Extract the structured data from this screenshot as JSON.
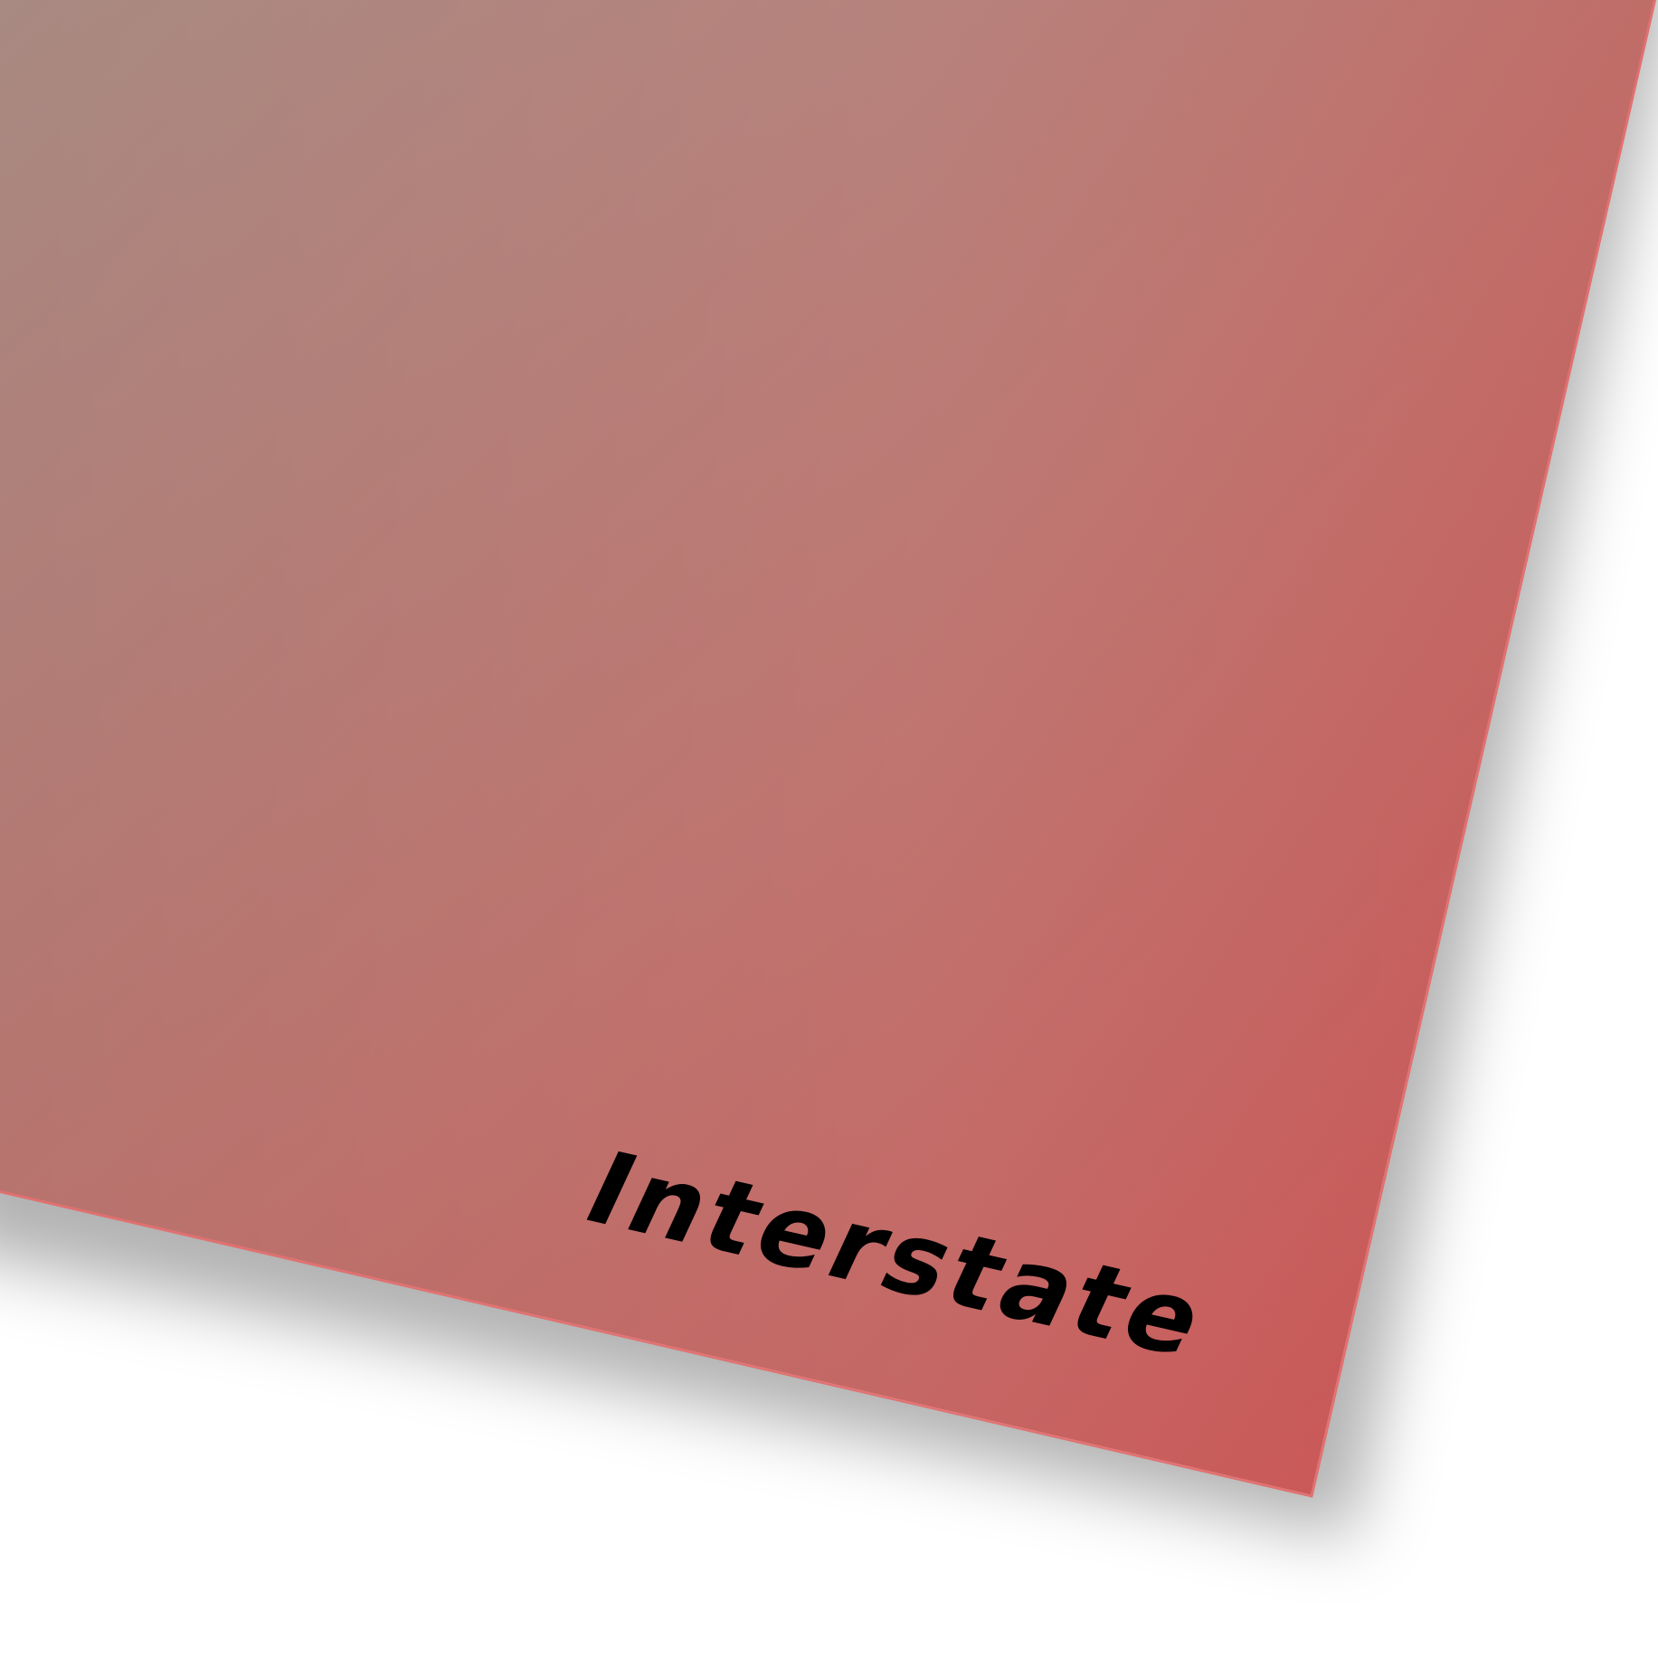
{
  "poster": {
    "caption": "Interstate",
    "colors": {
      "top_left": "#a88a82",
      "top_right": "#d06862",
      "bottom_left": "#9c6e68",
      "bottom_right": "#c84c4c",
      "edge": "#e07070",
      "text": "#000000",
      "background": "#ffffff"
    }
  }
}
